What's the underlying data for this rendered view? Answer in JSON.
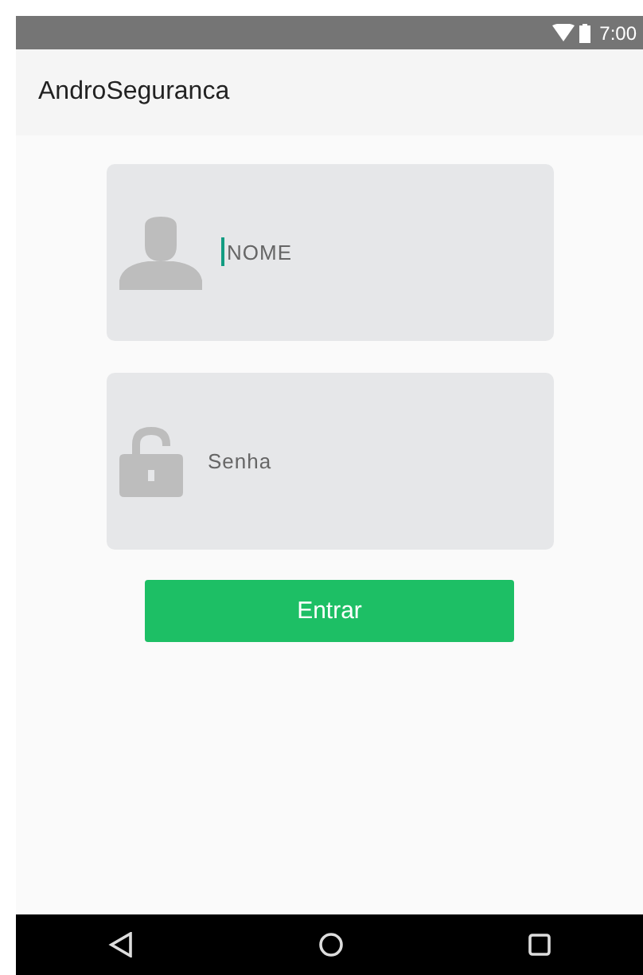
{
  "status_bar": {
    "time": "7:00"
  },
  "app_bar": {
    "title": "AndroSeguranca"
  },
  "fields": [
    {
      "kind": "user",
      "placeholder": "NOME",
      "focused": true
    },
    {
      "kind": "lock",
      "placeholder": "Senha",
      "focused": false
    }
  ],
  "button": {
    "label": "Entrar"
  }
}
